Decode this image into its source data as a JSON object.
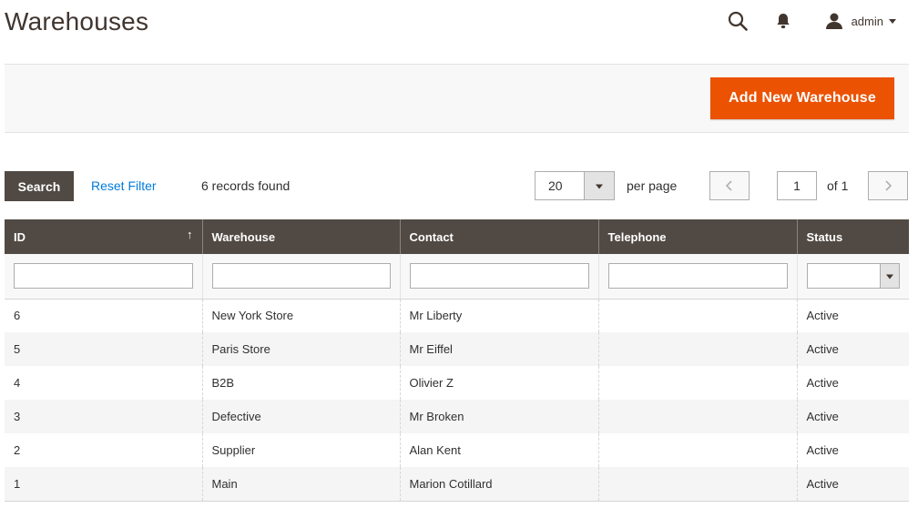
{
  "header": {
    "title": "Warehouses",
    "search_icon": "search-icon",
    "notification_icon": "bell-icon",
    "user": {
      "name": "admin",
      "icon": "user-icon"
    }
  },
  "actions": {
    "add_new_label": "Add New Warehouse"
  },
  "toolbar": {
    "search_label": "Search",
    "reset_label": "Reset Filter",
    "records_text": "6 records found",
    "per_page_value": "20",
    "per_page_label": "per page",
    "current_page": "1",
    "of_text": "of 1"
  },
  "grid": {
    "columns": [
      "ID",
      "Warehouse",
      "Contact",
      "Telephone",
      "Status"
    ],
    "sort_indicator": "↑",
    "rows": [
      {
        "id": "6",
        "warehouse": "New York Store",
        "contact": "Mr Liberty",
        "telephone": "",
        "status": "Active"
      },
      {
        "id": "5",
        "warehouse": "Paris Store",
        "contact": "Mr Eiffel",
        "telephone": "",
        "status": "Active"
      },
      {
        "id": "4",
        "warehouse": "B2B",
        "contact": "Olivier Z",
        "telephone": "",
        "status": "Active"
      },
      {
        "id": "3",
        "warehouse": "Defective",
        "contact": "Mr Broken",
        "telephone": "",
        "status": "Active"
      },
      {
        "id": "2",
        "warehouse": "Supplier",
        "contact": "Alan Kent",
        "telephone": "",
        "status": "Active"
      },
      {
        "id": "1",
        "warehouse": "Main",
        "contact": "Marion Cotillard",
        "telephone": "",
        "status": "Active"
      }
    ]
  },
  "colors": {
    "accent": "#eb5202",
    "header_bg": "#514943",
    "link": "#007bdb"
  }
}
